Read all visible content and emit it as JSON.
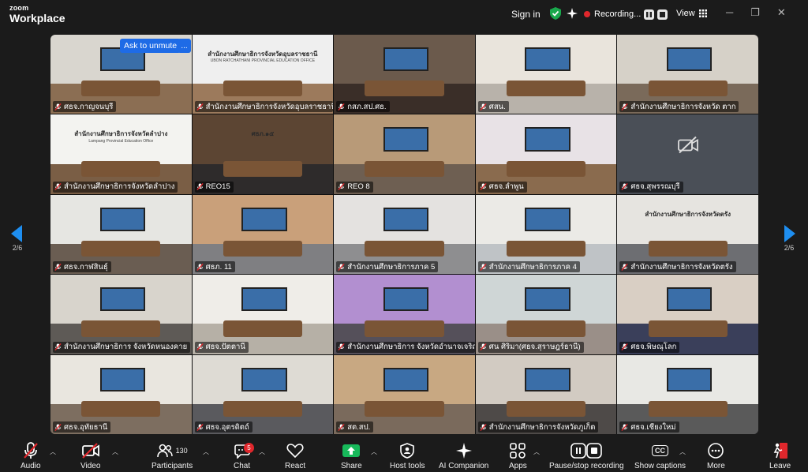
{
  "app": {
    "logo_top": "zoom",
    "logo_bottom": "Workplace"
  },
  "header": {
    "sign_in": "Sign in",
    "recording_label": "Recording...",
    "view_label": "View"
  },
  "colors": {
    "accent_blue": "#1e6be6",
    "record_red": "#e0272c",
    "secure_green": "#19a84c",
    "share_green": "#17b95a"
  },
  "overlay": {
    "unmute_label": "Ask to unmute",
    "more_label": "..."
  },
  "pagination": {
    "left": "2/6",
    "right": "2/6"
  },
  "participants": [
    {
      "name": "ศธจ.กาญจนบุรี",
      "wall": "#d9d6cf",
      "floor": "#8b6e53"
    },
    {
      "name": "สำนักงานศึกษาธิการจังหวัดอุบลราชธานี",
      "wall": "#efefef",
      "floor": "#9c7a5c",
      "banner": "สำนักงานศึกษาธิการจังหวัดอุบลราชธานี",
      "banner_en": "UBON RATCHATHANI PROVINCIAL EDUCATION OFFICE"
    },
    {
      "name": "กสภ.สป.ศธ.",
      "wall": "#6b5a4c",
      "floor": "#3a2e28"
    },
    {
      "name": "ศสน.",
      "wall": "#e9e4dc",
      "floor": "#b8b2aa"
    },
    {
      "name": "สำนักงานศึกษาธิการจังหวัด ตาก",
      "wall": "#d6d1c8",
      "floor": "#7a6a5a"
    },
    {
      "name": "สำนักงานศึกษาธิการจังหวัดลำปาง",
      "wall": "#f3f3f0",
      "floor": "#7a5e45",
      "banner": "สำนักงานศึกษาธิการจังหวัดลำปาง",
      "banner_en": "Lampang Provincial Education Office"
    },
    {
      "name": "REO15",
      "wall": "#5c4533",
      "floor": "#2e2b2b",
      "banner": "ศธภ.๑๕"
    },
    {
      "name": "REO 8",
      "wall": "#b89a78",
      "floor": "#6e5f52"
    },
    {
      "name": "ศธจ.ลำพูน",
      "wall": "#e8e2e6",
      "floor": "#8a6b4e"
    },
    {
      "name": "ศธจ.สุพรรณบุรี",
      "wall": "#2f2f2f",
      "floor": "#2f2f2f",
      "camera_off": true
    },
    {
      "name": "ศธจ.กาฬสินธุ์",
      "wall": "#e6e6e2",
      "floor": "#6a5d52"
    },
    {
      "name": "ศธภ. 11",
      "wall": "#c9a07a",
      "floor": "#7f7f82"
    },
    {
      "name": "สำนักงานศึกษาธิการภาค 5",
      "wall": "#e4e2e0",
      "floor": "#8e8e90"
    },
    {
      "name": "สำนักงานศึกษาธิการภาค 4",
      "wall": "#ebeae6",
      "floor": "#bfc3c6"
    },
    {
      "name": "สำนักงานศึกษาธิการจังหวัดตรัง",
      "wall": "#e6e4e0",
      "floor": "#6d6e72",
      "banner": "สำนักงานศึกษาธิการจังหวัดตรัง"
    },
    {
      "name": "สำนักงานศึกษาธิการ จังหวัดหนองคาย",
      "wall": "#d8d4cc",
      "floor": "#5e5a56"
    },
    {
      "name": "ศธจ.ปัตตานี",
      "wall": "#efede8",
      "floor": "#b6b0a6"
    },
    {
      "name": "สำนักงานศึกษาธิการ จังหวัดอำนาจเจริญ",
      "wall": "#b28fd0",
      "floor": "#55505a"
    },
    {
      "name": "ศน ศิริมา(ศธจ.สุราษฎร์ธานี)",
      "wall": "#cfd6d6",
      "floor": "#9a8f88"
    },
    {
      "name": "ศธจ.พิษณุโลก",
      "wall": "#d9cfc4",
      "floor": "#3a3f5a"
    },
    {
      "name": "ศธจ.อุทัยธานี",
      "wall": "#e9e6df",
      "floor": "#7d6e60"
    },
    {
      "name": "ศธจ.อุตรดิตถ์",
      "wall": "#dedbd4",
      "floor": "#5a5a5e"
    },
    {
      "name": "สต.สป.",
      "wall": "#c8a882",
      "floor": "#7a6a5c"
    },
    {
      "name": "สำนักงานศึกษาธิการจังหวัดภูเก็ต",
      "wall": "#d2cbc2",
      "floor": "#4e4a48"
    },
    {
      "name": "ศธจ.เชียงใหม่",
      "wall": "#e8e8e4",
      "floor": "#5a5a5a"
    }
  ],
  "toolbar": {
    "audio": "Audio",
    "video": "Video",
    "participants": "Participants",
    "participants_count": "130",
    "chat": "Chat",
    "chat_badge": "5",
    "react": "React",
    "share": "Share",
    "host_tools": "Host tools",
    "ai_companion": "AI Companion",
    "apps": "Apps",
    "pause_stop": "Pause/stop recording",
    "captions": "Show captions",
    "captions_icon_text": "CC",
    "more": "More",
    "leave": "Leave"
  }
}
